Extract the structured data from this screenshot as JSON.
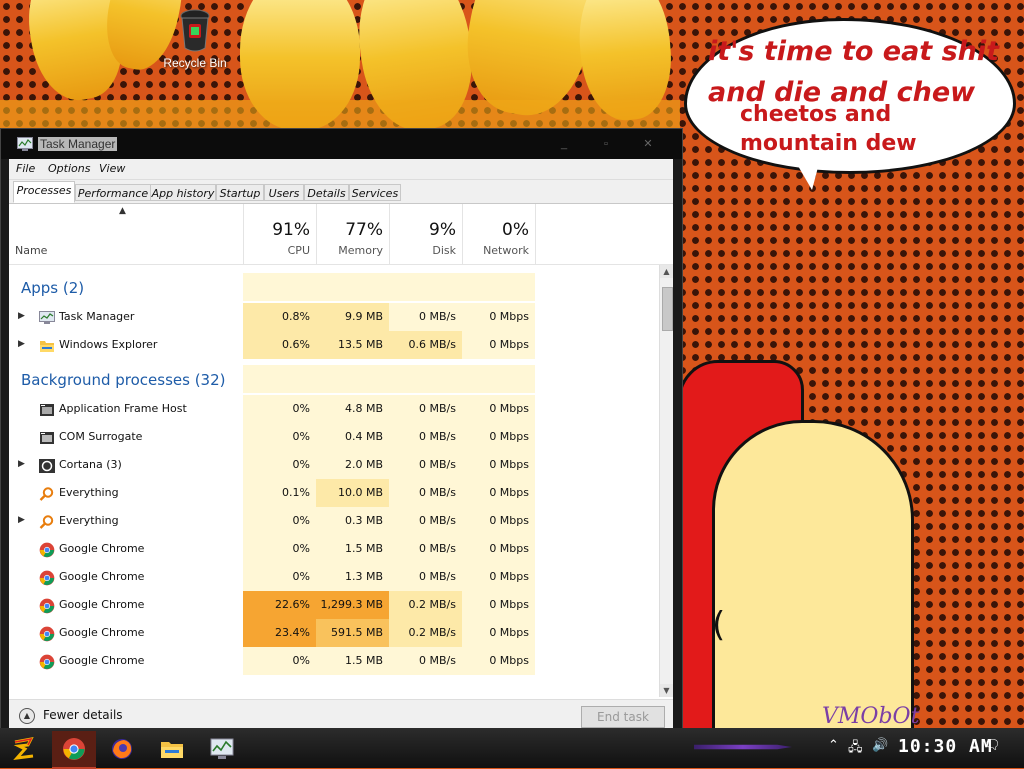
{
  "desktop": {
    "recycle_bin_label": "Recycle Bin",
    "speech_bubble": {
      "line1": "it's time to eat shit",
      "line2": "and die and chew",
      "line3": "cheetos and",
      "line4": "mountain dew"
    },
    "signature": "VMObOt"
  },
  "window": {
    "title": "Task Manager",
    "menu": [
      "File",
      "Options",
      "View"
    ],
    "tabs": [
      "Processes",
      "Performance",
      "App history",
      "Startup",
      "Users",
      "Details",
      "Services"
    ],
    "active_tab": "Processes",
    "columns": {
      "name": "Name",
      "cpu": {
        "pct": "91%",
        "label": "CPU"
      },
      "memory": {
        "pct": "77%",
        "label": "Memory"
      },
      "disk": {
        "pct": "9%",
        "label": "Disk"
      },
      "network": {
        "pct": "0%",
        "label": "Network"
      }
    },
    "groups": {
      "apps": "Apps (2)",
      "background": "Background processes (32)"
    },
    "apps": [
      {
        "name": "Task Manager",
        "cpu": "0.8%",
        "memory": "9.9 MB",
        "disk": "0 MB/s",
        "network": "0 Mbps",
        "icon": "task-manager-icon",
        "expandable": true
      },
      {
        "name": "Windows Explorer",
        "cpu": "0.6%",
        "memory": "13.5 MB",
        "disk": "0.6 MB/s",
        "network": "0 Mbps",
        "icon": "folder-icon",
        "expandable": true
      }
    ],
    "background": [
      {
        "name": "Application Frame Host",
        "cpu": "0%",
        "memory": "4.8 MB",
        "disk": "0 MB/s",
        "network": "0 Mbps",
        "icon": "app-frame-icon",
        "expandable": false
      },
      {
        "name": "COM Surrogate",
        "cpu": "0%",
        "memory": "0.4 MB",
        "disk": "0 MB/s",
        "network": "0 Mbps",
        "icon": "com-surrogate-icon",
        "expandable": false
      },
      {
        "name": "Cortana (3)",
        "cpu": "0%",
        "memory": "2.0 MB",
        "disk": "0 MB/s",
        "network": "0 Mbps",
        "icon": "cortana-icon",
        "expandable": true
      },
      {
        "name": "Everything",
        "cpu": "0.1%",
        "memory": "10.0 MB",
        "disk": "0 MB/s",
        "network": "0 Mbps",
        "icon": "search-icon",
        "expandable": false
      },
      {
        "name": "Everything",
        "cpu": "0%",
        "memory": "0.3 MB",
        "disk": "0 MB/s",
        "network": "0 Mbps",
        "icon": "search-icon",
        "expandable": true
      },
      {
        "name": "Google Chrome",
        "cpu": "0%",
        "memory": "1.5 MB",
        "disk": "0 MB/s",
        "network": "0 Mbps",
        "icon": "chrome-icon",
        "expandable": false
      },
      {
        "name": "Google Chrome",
        "cpu": "0%",
        "memory": "1.3 MB",
        "disk": "0 MB/s",
        "network": "0 Mbps",
        "icon": "chrome-icon",
        "expandable": false
      },
      {
        "name": "Google Chrome",
        "cpu": "22.6%",
        "memory": "1,299.3 MB",
        "disk": "0.2 MB/s",
        "network": "0 Mbps",
        "icon": "chrome-icon",
        "expandable": false
      },
      {
        "name": "Google Chrome",
        "cpu": "23.4%",
        "memory": "591.5 MB",
        "disk": "0.2 MB/s",
        "network": "0 Mbps",
        "icon": "chrome-icon",
        "expandable": false
      },
      {
        "name": "Google Chrome",
        "cpu": "0%",
        "memory": "1.5 MB",
        "disk": "0 MB/s",
        "network": "0 Mbps",
        "icon": "chrome-icon",
        "expandable": false
      }
    ],
    "footer": {
      "fewer_details": "Fewer details",
      "end_task": "End task"
    }
  },
  "taskbar": {
    "clock": "10:30 AM",
    "items": [
      "start",
      "chrome",
      "firefox",
      "file-explorer",
      "task-manager"
    ]
  },
  "colors": {
    "heat_light": "#fff7d6",
    "heat_mid": "#fde9a8",
    "heat_high": "#f9c25c",
    "heat_max": "#f6a532",
    "group_blue": "#1e5ca8"
  }
}
